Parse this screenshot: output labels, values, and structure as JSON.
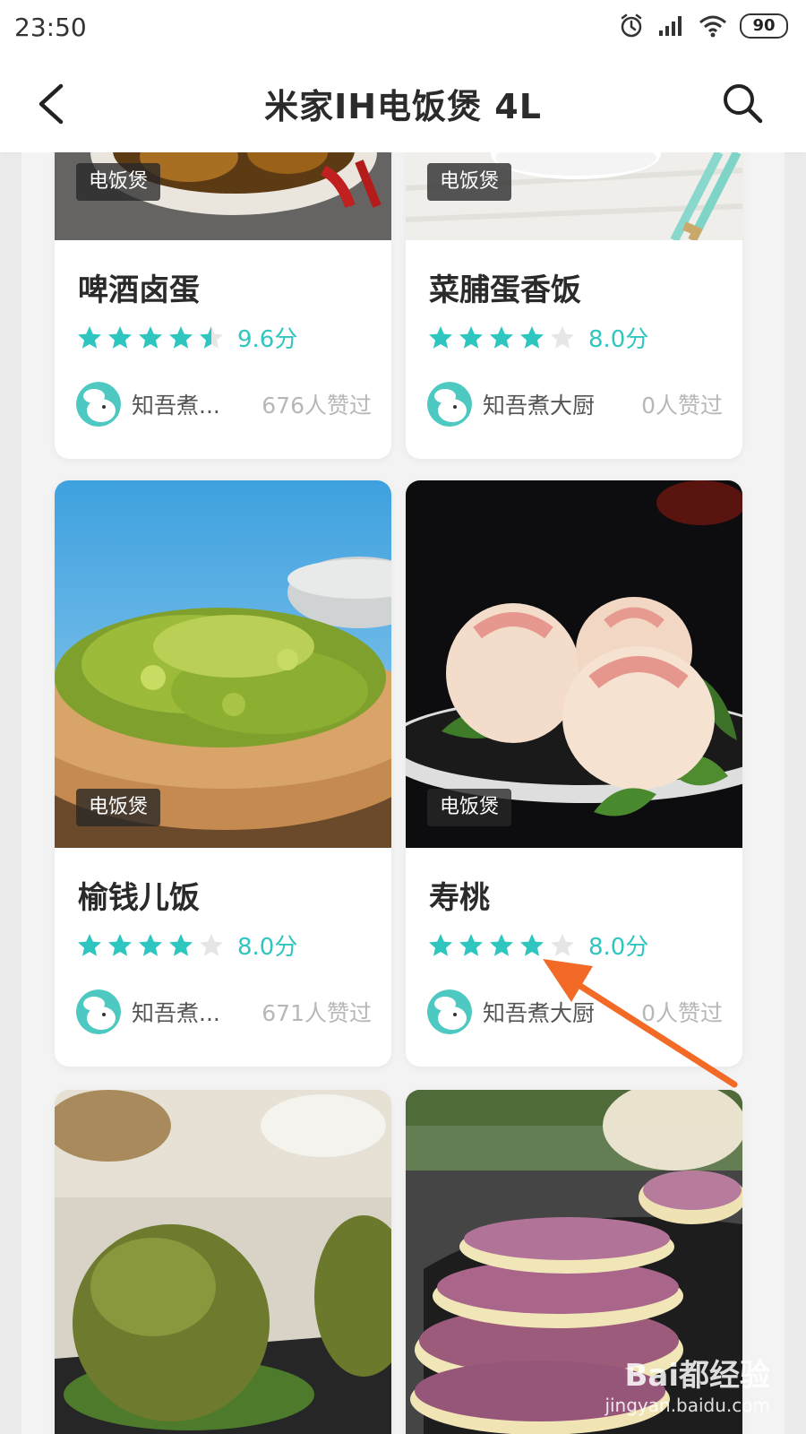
{
  "status_bar": {
    "time": "23:50",
    "battery": "90"
  },
  "nav": {
    "title": "米家IH电饭煲 4L"
  },
  "cards": [
    {
      "tag": "电饭煲",
      "title": "啤酒卤蛋",
      "score": "9.6分",
      "rating": 4.5,
      "author": "知吾煮...",
      "likes": "676人赞过"
    },
    {
      "tag": "电饭煲",
      "title": "菜脯蛋香饭",
      "score": "8.0分",
      "rating": 4,
      "author": "知吾煮大厨",
      "likes": "0人赞过"
    },
    {
      "tag": "电饭煲",
      "title": "榆钱儿饭",
      "score": "8.0分",
      "rating": 4,
      "author": "知吾煮...",
      "likes": "671人赞过"
    },
    {
      "tag": "电饭煲",
      "title": "寿桃",
      "score": "8.0分",
      "rating": 4,
      "author": "知吾煮大厨",
      "likes": "0人赞过"
    }
  ],
  "watermark": {
    "logo": "Bai都经验",
    "url": "jingyan.baidu.com"
  },
  "colors": {
    "accent": "#2fc6c0",
    "arrow": "#f26a25"
  }
}
